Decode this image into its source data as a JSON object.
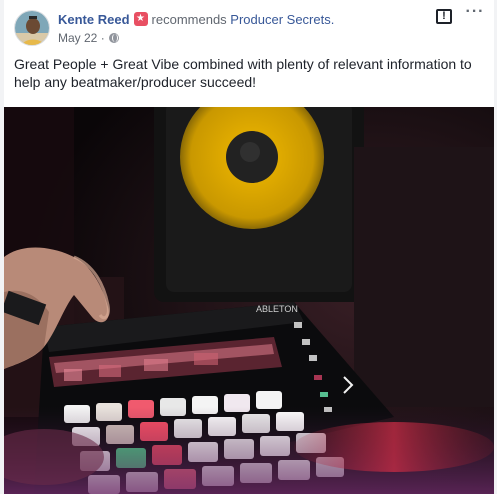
{
  "post": {
    "author": "Kente Reed",
    "verb": "recommends",
    "page": "Producer Secrets.",
    "date": "May 22",
    "separator": "·",
    "text": "Great People + Great Vibe combined with plenty of relevant information to help any beatmaker/producer succeed!",
    "report_icon": "!",
    "more_icon": "···"
  },
  "icons": {
    "recommend_badge": "recommend-icon",
    "privacy": "globe-icon",
    "report": "report-icon",
    "more": "more-icon"
  },
  "photo": {
    "logo_text": "ABLETON"
  },
  "colors": {
    "link": "#385898",
    "text": "#1d2129",
    "meta": "#616770",
    "badge": "#e84f62",
    "speaker_cone": "#d8a500"
  }
}
